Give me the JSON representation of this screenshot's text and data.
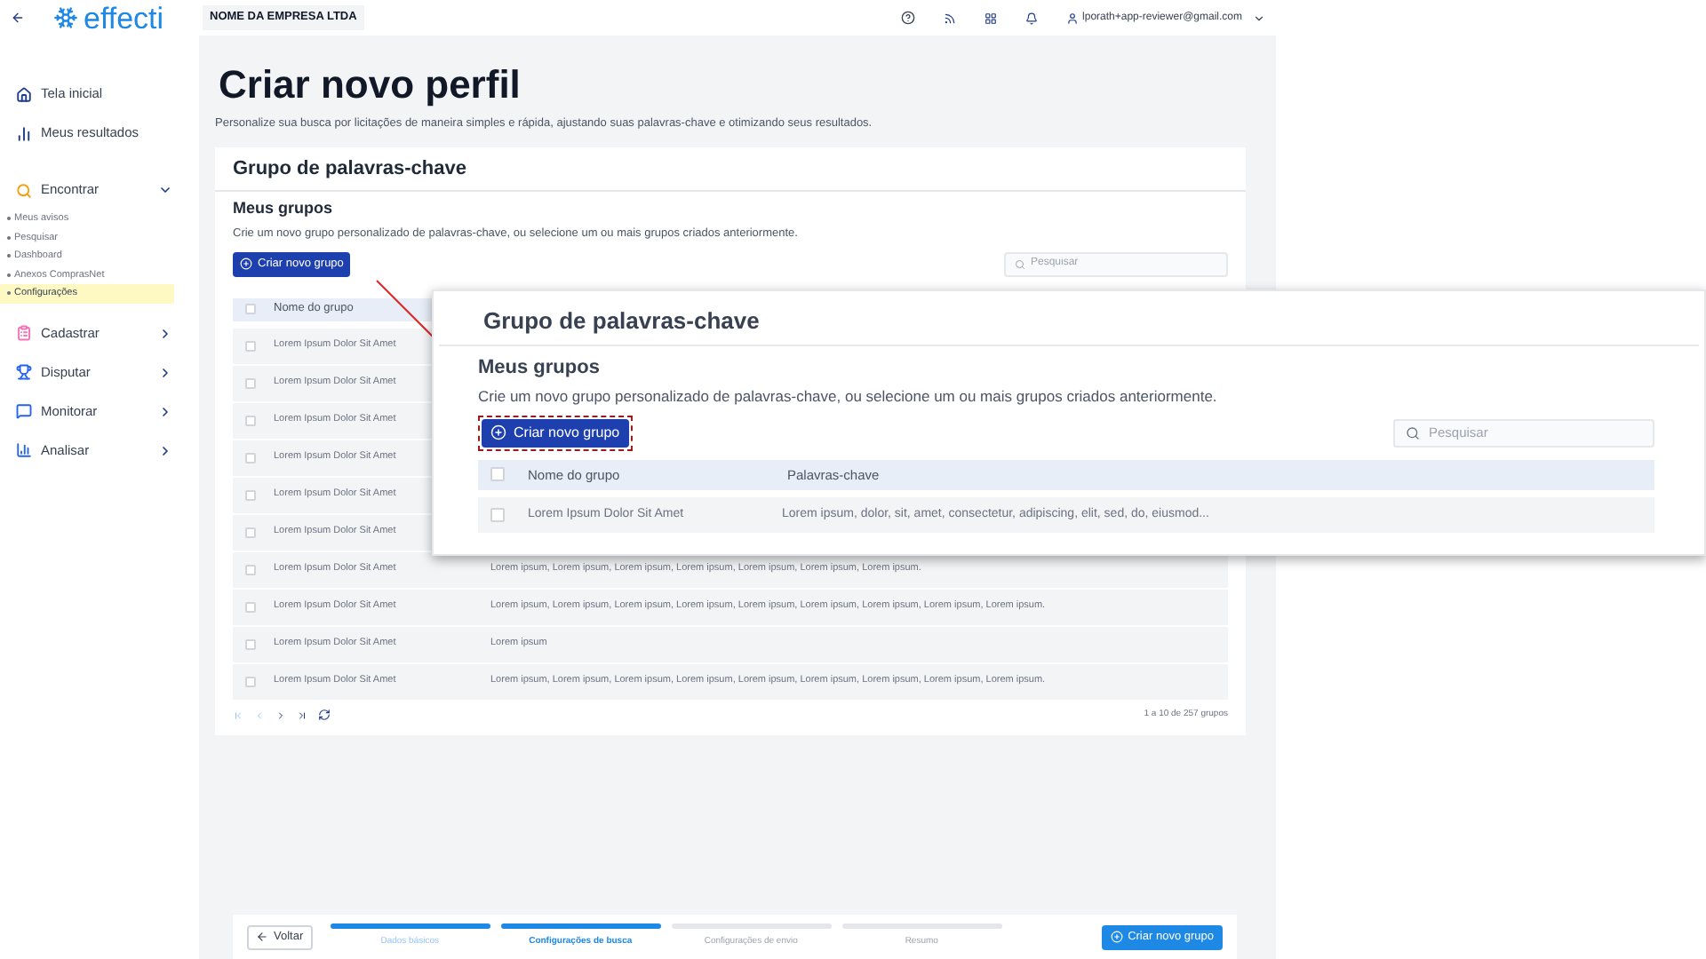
{
  "header": {
    "logo": "effecti",
    "company": "NOME DA EMPRESA LTDA",
    "user": "lporath+app-reviewer@gmail.com"
  },
  "sidebar": {
    "items": [
      {
        "label": "Tela inicial"
      },
      {
        "label": "Meus resultados"
      },
      {
        "label": "Encontrar",
        "expanded": true,
        "children": [
          {
            "label": "Meus avisos",
            "selected": false
          },
          {
            "label": "Pesquisar",
            "selected": false
          },
          {
            "label": "Dashboard",
            "selected": false
          },
          {
            "label": "Anexos ComprasNet",
            "selected": false
          },
          {
            "label": "Configurações",
            "selected": true
          }
        ]
      },
      {
        "label": "Cadastrar",
        "expanded": false
      },
      {
        "label": "Disputar",
        "expanded": false
      },
      {
        "label": "Monitorar",
        "expanded": false
      },
      {
        "label": "Analisar",
        "expanded": false
      }
    ]
  },
  "page": {
    "title": "Criar novo perfil",
    "subtitle": "Personalize sua busca por licitações de maneira simples e rápida, ajustando suas palavras-chave e otimizando seus resultados."
  },
  "card": {
    "title": "Grupo de palavras-chave",
    "section": "Meus grupos",
    "description": "Crie um novo grupo personalizado de palavras-chave, ou selecione um ou mais grupos criados anteriormente.",
    "create_button": "Criar novo grupo",
    "search": {
      "placeholder": "Pesquisar"
    },
    "columns": [
      "Nome do grupo"
    ],
    "header_checked": false,
    "rows": [
      {
        "name": "Lorem Ipsum Dolor Sit Amet",
        "checked": false
      },
      {
        "name": "Lorem Ipsum Dolor Sit Amet",
        "checked": false
      },
      {
        "name": "Lorem Ipsum Dolor Sit Amet",
        "checked": false
      },
      {
        "name": "Lorem Ipsum Dolor Sit Amet",
        "checked": false
      },
      {
        "name": "Lorem Ipsum Dolor Sit Amet",
        "checked": false
      },
      {
        "name": "Lorem Ipsum Dolor Sit Amet",
        "checked": false
      },
      {
        "name": "Lorem Ipsum Dolor Sit Amet",
        "keywords": "Lorem ipsum, Lorem ipsum, Lorem ipsum, Lorem ipsum, Lorem ipsum, Lorem ipsum, Lorem ipsum.",
        "checked": false
      },
      {
        "name": "Lorem Ipsum Dolor Sit Amet",
        "keywords": "Lorem ipsum, Lorem ipsum, Lorem ipsum, Lorem ipsum, Lorem ipsum, Lorem ipsum, Lorem ipsum, Lorem ipsum, Lorem ipsum.",
        "checked": false
      },
      {
        "name": "Lorem Ipsum Dolor Sit Amet",
        "keywords": "Lorem ipsum",
        "checked": false
      },
      {
        "name": "Lorem Ipsum Dolor Sit Amet",
        "keywords": "Lorem ipsum, Lorem ipsum, Lorem ipsum, Lorem ipsum, Lorem ipsum, Lorem ipsum, Lorem ipsum, Lorem ipsum, Lorem ipsum.",
        "checked": false
      }
    ],
    "pagination": "1 a 10 de 257 grupos"
  },
  "callout": {
    "title": "Grupo de palavras-chave",
    "section": "Meus grupos",
    "description": "Crie um novo grupo personalizado de palavras-chave, ou selecione um ou mais grupos criados anteriormente.",
    "create_button": "Criar novo grupo",
    "search": {
      "placeholder": "Pesquisar"
    },
    "columns": [
      "Nome do grupo",
      "Palavras-chave"
    ],
    "header_checked": false,
    "rows": [
      {
        "name": "Lorem Ipsum Dolor Sit Amet",
        "keywords": "Lorem ipsum, dolor, sit, amet, consectetur, adipiscing, elit, sed, do, eiusmod...",
        "checked": false
      }
    ]
  },
  "footer": {
    "back_button": "Voltar",
    "steps": [
      {
        "label": "Dados básicos",
        "completed": true,
        "selected": false
      },
      {
        "label": "Configurações de busca",
        "completed": false,
        "selected": true
      },
      {
        "label": "Configurações de envio",
        "completed": false,
        "selected": false
      },
      {
        "label": "Resumo",
        "completed": false,
        "selected": false
      }
    ],
    "submit_button": "Criar novo grupo"
  }
}
